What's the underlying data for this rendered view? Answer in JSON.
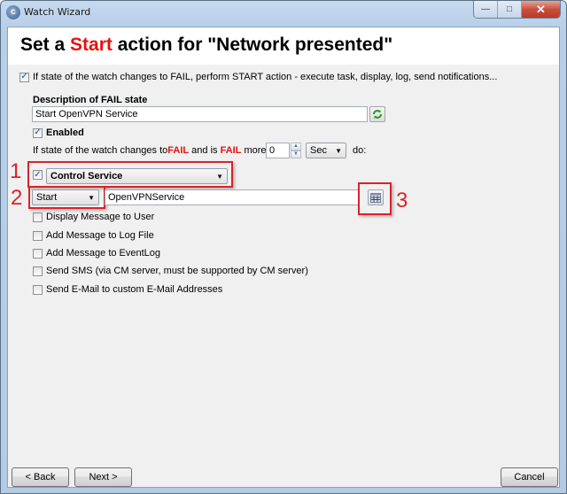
{
  "window": {
    "title": "Watch Wizard",
    "controls": {
      "minimize": "minimize-icon",
      "maximize": "maximize-icon",
      "close": "close-icon"
    }
  },
  "header": {
    "prefix": "Set a ",
    "action": "Start",
    "suffix": " action for \"Network presented\"",
    "action_color": "#e81010"
  },
  "main": {
    "perform_checkbox": {
      "checked": true,
      "label": "If state of the watch changes to FAIL, perform START action - execute task, display, log, send notifications..."
    },
    "description_label": "Description of FAIL state",
    "description_value": "Start OpenVPN Service",
    "refresh_icon": "refresh-icon",
    "enabled": {
      "checked": true,
      "label": "Enabled"
    },
    "condition": {
      "part1": "If state of the watch changes to ",
      "fail1": "FAIL",
      "part2": " and is ",
      "fail2": "FAIL",
      "part3": " more than",
      "value": "0",
      "unit": "Sec",
      "suffix": "do:"
    },
    "control_service": {
      "checked": true,
      "label": "Control Service"
    },
    "service_action": "Start",
    "service_name": "OpenVPNService",
    "browse_icon": "service-list-icon",
    "options": [
      {
        "checked": false,
        "label": "Display Message to User"
      },
      {
        "checked": false,
        "label": "Add Message to Log File"
      },
      {
        "checked": false,
        "label": "Add Message to EventLog"
      },
      {
        "checked": false,
        "label": "Send SMS (via CM server, must be supported by CM server)"
      },
      {
        "checked": false,
        "label": "Send E-Mail to custom E-Mail Addresses"
      }
    ]
  },
  "annotations": [
    "1",
    "2",
    "3"
  ],
  "footer": {
    "back": "< Back",
    "next": "Next >",
    "cancel": "Cancel"
  }
}
